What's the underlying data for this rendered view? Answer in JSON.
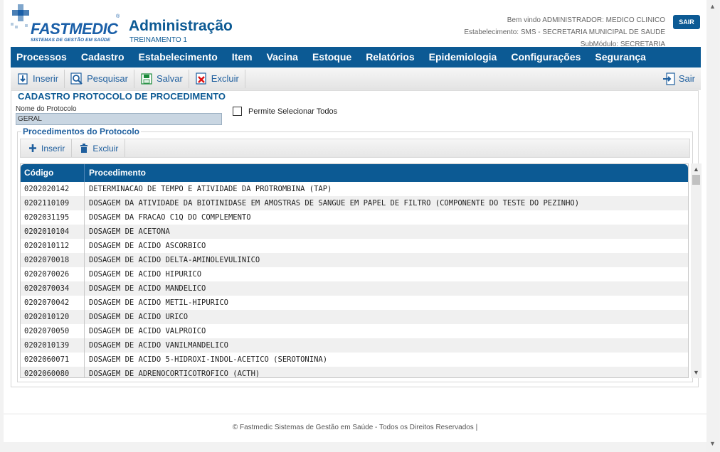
{
  "brand": {
    "name": "FASTMEDIC",
    "tagline": "SISTEMAS DE GESTÃO EM SAÚDE",
    "reg": "®"
  },
  "header": {
    "title": "Administração",
    "subtitle": "TREINAMENTO 1",
    "welcome": "Bem vindo ADMINISTRADOR: MEDICO CLINICO",
    "establishment": "Estabelecimento: SMS - SECRETARIA MUNICIPAL DE SAUDE",
    "submodule": "SubMódulo: SECRETARIA",
    "logout_label": "SAIR"
  },
  "menu": [
    {
      "label": "Processos"
    },
    {
      "label": "Cadastro"
    },
    {
      "label": "Estabelecimento"
    },
    {
      "label": "Item"
    },
    {
      "label": "Vacina"
    },
    {
      "label": "Estoque"
    },
    {
      "label": "Relatórios"
    },
    {
      "label": "Epidemiologia"
    },
    {
      "label": "Configurações"
    },
    {
      "label": "Segurança"
    }
  ],
  "toolbar": {
    "insert": "Inserir",
    "search": "Pesquisar",
    "save": "Salvar",
    "delete": "Excluir",
    "exit": "Sair"
  },
  "form": {
    "title": "CADASTRO PROTOCOLO DE PROCEDIMENTO",
    "name_label": "Nome do Protocolo",
    "name_value": "GERAL",
    "select_all_label": "Permite Selecionar Todos",
    "select_all_checked": false
  },
  "procedures": {
    "title": "Procedimentos do Protocolo",
    "insert": "Inserir",
    "delete": "Excluir",
    "columns": [
      "Código",
      "Procedimento"
    ],
    "rows": [
      [
        "0202020142",
        "DETERMINACAO DE TEMPO E ATIVIDADE DA PROTROMBINA (TAP)"
      ],
      [
        "0202110109",
        "DOSAGEM DA ATIVIDADE DA BIOTINIDASE EM AMOSTRAS DE SANGUE EM PAPEL DE FILTRO (COMPONENTE DO TESTE DO PEZINHO)"
      ],
      [
        "0202031195",
        "DOSAGEM DA FRACAO C1Q DO COMPLEMENTO"
      ],
      [
        "0202010104",
        "DOSAGEM DE ACETONA"
      ],
      [
        "0202010112",
        "DOSAGEM DE ACIDO ASCORBICO"
      ],
      [
        "0202070018",
        "DOSAGEM DE ACIDO DELTA-AMINOLEVULINICO"
      ],
      [
        "0202070026",
        "DOSAGEM DE ACIDO HIPURICO"
      ],
      [
        "0202070034",
        "DOSAGEM DE ACIDO MANDELICO"
      ],
      [
        "0202070042",
        "DOSAGEM DE ACIDO METIL-HIPURICO"
      ],
      [
        "0202010120",
        "DOSAGEM DE ACIDO URICO"
      ],
      [
        "0202070050",
        "DOSAGEM DE ACIDO VALPROICO"
      ],
      [
        "0202010139",
        "DOSAGEM DE ACIDO VANILMANDELICO"
      ],
      [
        "0202060071",
        "DOSAGEM DE ACIDO 5-HIDROXI-INDOL-ACETICO (SEROTONINA)"
      ],
      [
        "0202060080",
        "DOSAGEM DE ADRENOCORTICOTROFICO (ACTH)"
      ]
    ]
  },
  "footer": {
    "text": "© Fastmedic Sistemas de Gestão em Saúde - Todos os Direitos Reservados |"
  },
  "colors": {
    "primary": "#0c5a94",
    "link": "#1f5f9e",
    "row_alt": "#f0f0f0"
  }
}
